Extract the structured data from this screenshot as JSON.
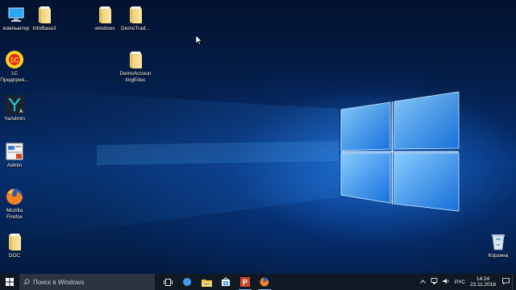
{
  "desktop": {
    "icons": [
      {
        "label": "компьютер",
        "icon": "this-pc-icon"
      },
      {
        "label": "InfoBase3",
        "icon": "folder-icon"
      },
      {
        "label": "windows",
        "icon": "folder-icon"
      },
      {
        "label": "DemoTrad...",
        "icon": "folder-icon"
      },
      {
        "label": "DemoAccountingEduc",
        "icon": "folder-icon"
      },
      {
        "label": "1С Предприя...",
        "icon": "1c-enterprise-icon"
      },
      {
        "label": "YaAdmin",
        "icon": "yaadmin-icon"
      },
      {
        "label": "Admin",
        "icon": "admin-document-icon"
      },
      {
        "label": "Mozilla Firefox",
        "icon": "firefox-icon"
      },
      {
        "label": "DOC",
        "icon": "folder-icon"
      },
      {
        "label": "Корзина",
        "icon": "recycle-bin-icon"
      }
    ]
  },
  "taskbar": {
    "search_placeholder": "Поиск в Windows",
    "apps": [
      "task-view-icon",
      "edge-icon",
      "file-explorer-icon",
      "store-icon",
      "powerpoint-icon",
      "firefox-icon"
    ],
    "tray": {
      "language": "РУС",
      "time": "14:24",
      "date": "23.11.2016"
    }
  },
  "colors": {
    "taskbar_bg": "#101823",
    "search_bg": "#2b3240",
    "wallpaper_blue": "#1e88ff"
  }
}
